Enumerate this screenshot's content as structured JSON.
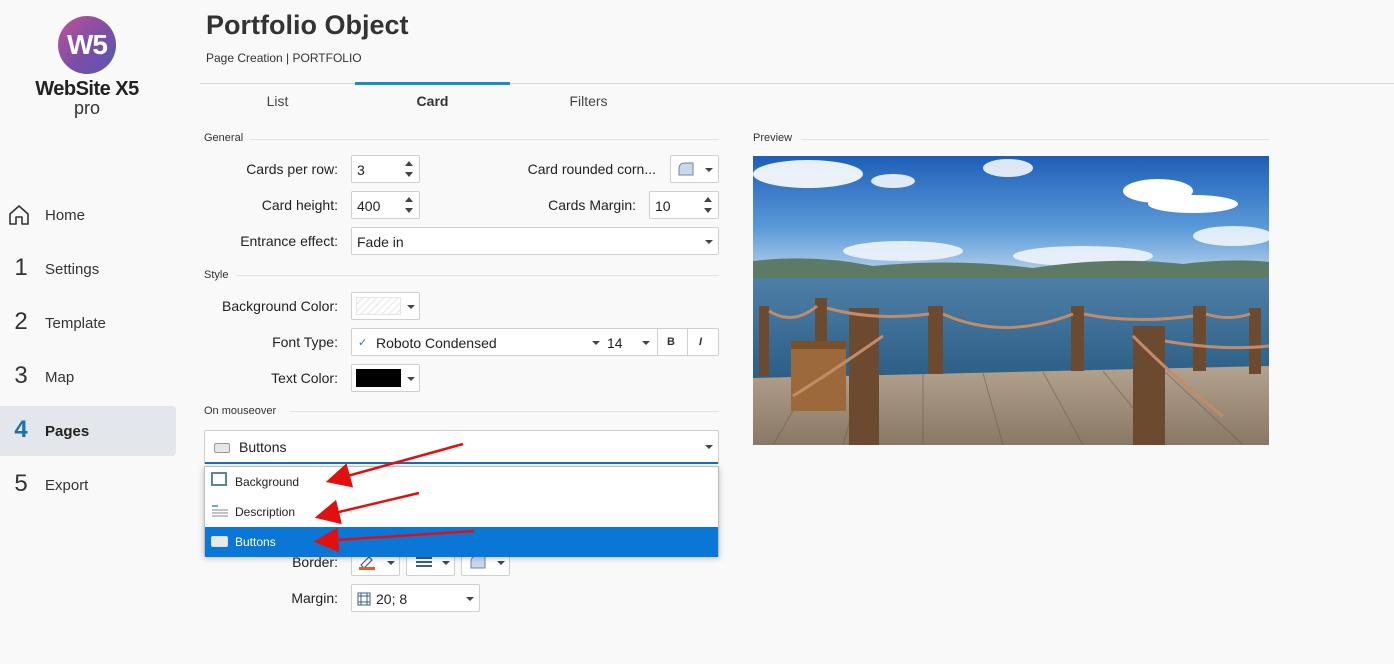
{
  "logo": {
    "badge": "W5",
    "name": "WebSite X5",
    "edition": "pro"
  },
  "nav": [
    {
      "num": "",
      "label": "Home",
      "icon": "home-icon"
    },
    {
      "num": "1",
      "label": "Settings"
    },
    {
      "num": "2",
      "label": "Template"
    },
    {
      "num": "3",
      "label": "Map"
    },
    {
      "num": "4",
      "label": "Pages",
      "active": true
    },
    {
      "num": "5",
      "label": "Export"
    }
  ],
  "header": {
    "title": "Portfolio Object",
    "breadcrumb": "Page Creation | PORTFOLIO"
  },
  "tabs": [
    {
      "label": "List"
    },
    {
      "label": "Card",
      "active": true
    },
    {
      "label": "Filters"
    }
  ],
  "general": {
    "section": "General",
    "cards_per_row_label": "Cards per row:",
    "cards_per_row": "3",
    "card_rounded_label": "Card rounded corn...",
    "card_height_label": "Card height:",
    "card_height": "400",
    "cards_margin_label": "Cards Margin:",
    "cards_margin": "10",
    "entrance_label": "Entrance effect:",
    "entrance": "Fade in"
  },
  "style": {
    "section": "Style",
    "bg_color_label": "Background Color:",
    "font_type_label": "Font Type:",
    "font_check": "✓",
    "font_name": "Roboto Condensed",
    "font_size": "14",
    "bold": "B",
    "italic": "I",
    "text_color_label": "Text Color:",
    "text_color": "#000000"
  },
  "mouseover": {
    "section": "On mouseover",
    "selected": "Buttons",
    "options": [
      {
        "label": "Background",
        "icon": "background-icon"
      },
      {
        "label": "Description",
        "icon": "description-icon"
      },
      {
        "label": "Buttons",
        "icon": "buttons-icon",
        "selected": true
      }
    ],
    "border_label": "Border:",
    "margin_label": "Margin:",
    "margin": "20; 8"
  },
  "preview": {
    "section": "Preview"
  },
  "colors": {
    "accent": "#1a8fbf",
    "selection": "#0a76d6",
    "arrow": "#e01010"
  }
}
